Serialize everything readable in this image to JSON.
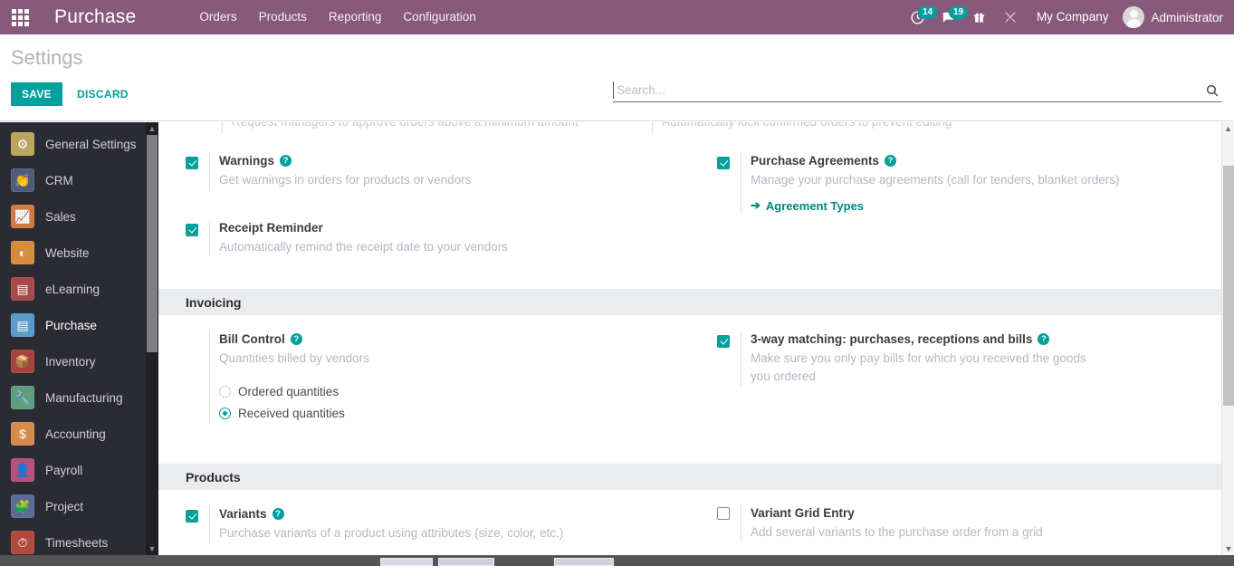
{
  "navbar": {
    "apps_icon": "apps-grid-icon",
    "brand": "Purchase",
    "menu": [
      {
        "label": "Orders"
      },
      {
        "label": "Products"
      },
      {
        "label": "Reporting"
      },
      {
        "label": "Configuration"
      }
    ],
    "activities": {
      "icon": "clock-activity-icon",
      "count": "14"
    },
    "messages": {
      "icon": "chat-bubble-icon",
      "count": "19"
    },
    "gift": {
      "icon": "gift-icon"
    },
    "tools": {
      "icon": "tools-wrench-icon"
    },
    "company": "My Company",
    "user": "Administrator"
  },
  "control_panel": {
    "title": "Settings",
    "save_label": "SAVE",
    "discard_label": "DISCARD",
    "search_placeholder": "Search...",
    "search_value": "",
    "search_icon": "search-icon"
  },
  "sidebar": {
    "items": [
      {
        "label": "General Settings",
        "icon": "gear-icon",
        "color": "#b8a55e",
        "glyph": "⚙",
        "active": false
      },
      {
        "label": "CRM",
        "icon": "handshake-icon",
        "color": "#4e5d7a",
        "glyph": "☝",
        "active": false
      },
      {
        "label": "Sales",
        "icon": "chart-line-icon",
        "color": "#d17a43",
        "glyph": "↗",
        "active": false
      },
      {
        "label": "Website",
        "icon": "globe-icon",
        "color": "#d78b3e",
        "glyph": "◔",
        "active": false
      },
      {
        "label": "eLearning",
        "icon": "graduation-icon",
        "color": "#a84a4a",
        "glyph": "◤",
        "active": false
      },
      {
        "label": "Purchase",
        "icon": "card-icon",
        "color": "#5a9cc9",
        "glyph": "▤",
        "active": true
      },
      {
        "label": "Inventory",
        "icon": "box-icon",
        "color": "#a8423c",
        "glyph": "⬟",
        "active": false
      },
      {
        "label": "Manufacturing",
        "icon": "wrench-icon",
        "color": "#5e9c7c",
        "glyph": "⚒",
        "active": false
      },
      {
        "label": "Accounting",
        "icon": "invoice-icon",
        "color": "#d68a4c",
        "glyph": "$",
        "active": false
      },
      {
        "label": "Payroll",
        "icon": "employee-icon",
        "color": "#b5517a",
        "glyph": "☺",
        "active": false
      },
      {
        "label": "Project",
        "icon": "puzzle-icon",
        "color": "#5b6b95",
        "glyph": "✦",
        "active": false
      },
      {
        "label": "Timesheets",
        "icon": "stopwatch-icon",
        "color": "#b04a3f",
        "glyph": "⏱",
        "active": false
      }
    ]
  },
  "settings": {
    "clipped_top": {
      "left": "Request managers to approve orders above a minimum amount",
      "right": "Automatically lock confirmed orders to prevent editing"
    },
    "orders": {
      "warnings": {
        "title": "Warnings",
        "desc": "Get warnings in orders for products or vendors",
        "checked": true,
        "help": "?"
      },
      "receipt_reminder": {
        "title": "Receipt Reminder",
        "desc": "Automatically remind the receipt date to your vendors",
        "checked": true
      },
      "purchase_agreements": {
        "title": "Purchase Agreements",
        "desc": "Manage your purchase agreements (call for tenders, blanket orders)",
        "checked": true,
        "help": "?",
        "link": "Agreement Types",
        "link_arrow": "➔"
      }
    },
    "invoicing": {
      "section_title": "Invoicing",
      "bill_control": {
        "title": "Bill Control",
        "desc": "Quantities billed by vendors",
        "help": "?",
        "options": [
          {
            "label": "Ordered quantities",
            "selected": false
          },
          {
            "label": "Received quantities",
            "selected": true
          }
        ]
      },
      "three_way_matching": {
        "title": "3-way matching: purchases, receptions and bills",
        "desc": "Make sure you only pay bills for which you received the goods you ordered",
        "checked": true,
        "help": "?"
      }
    },
    "products": {
      "section_title": "Products",
      "variants": {
        "title": "Variants",
        "desc": "Purchase variants of a product using attributes (size, color, etc.)",
        "checked": true,
        "help": "?"
      },
      "variant_grid_entry": {
        "title": "Variant Grid Entry",
        "desc": "Add several variants to the purchase order from a grid",
        "checked": false
      }
    },
    "clipped_bottom": {
      "left": "Purchase variants of a product using attributes (size, color, etc.)"
    }
  },
  "colors": {
    "brand_purple": "#875A7B",
    "accent_teal": "#00A09D",
    "sidebar_dark": "#2b2b33",
    "section_header_bg": "#eaecef"
  }
}
